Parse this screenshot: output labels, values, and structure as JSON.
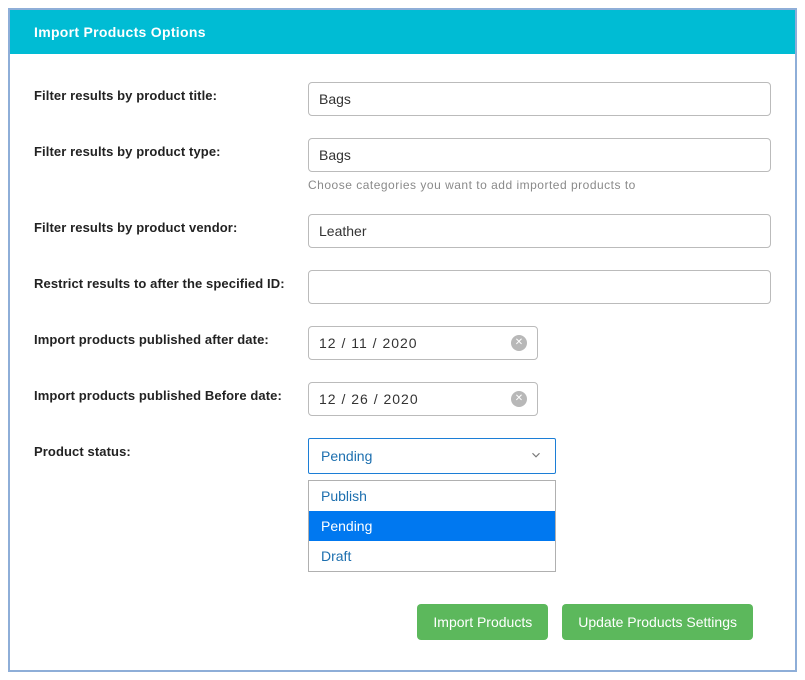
{
  "header": {
    "title": "Import Products Options"
  },
  "form": {
    "title_filter": {
      "label": "Filter results by product title:",
      "value": "Bags"
    },
    "type_filter": {
      "label": "Filter results by product type:",
      "value": "Bags",
      "helper": "Choose categories you want to add imported products to"
    },
    "vendor_filter": {
      "label": "Filter results by product vendor:",
      "value": "Leather"
    },
    "restrict_id": {
      "label": "Restrict results to after the specified ID:",
      "value": ""
    },
    "published_after": {
      "label": "Import products published after date:",
      "value": "12 / 11 / 2020"
    },
    "published_before": {
      "label": "Import products published Before date:",
      "value": "12 / 26 / 2020"
    },
    "status": {
      "label": "Product status:",
      "selected": "Pending",
      "options": {
        "opt0": "Publish",
        "opt1": "Pending",
        "opt2": "Draft"
      }
    }
  },
  "buttons": {
    "import": "Import Products",
    "update": "Update Products Settings"
  }
}
